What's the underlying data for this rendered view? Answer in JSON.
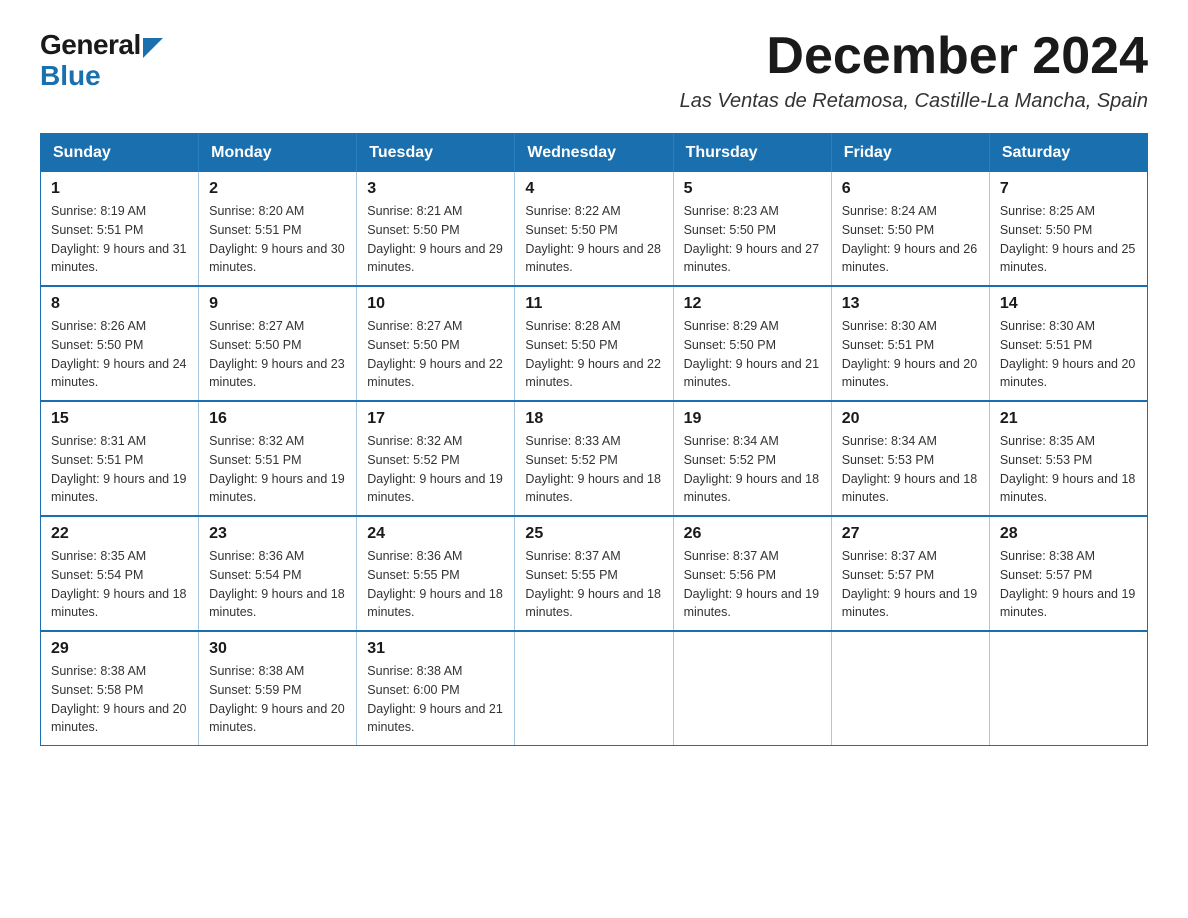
{
  "header": {
    "logo_general": "General",
    "logo_blue": "Blue",
    "month_year": "December 2024",
    "location": "Las Ventas de Retamosa, Castille-La Mancha, Spain"
  },
  "calendar": {
    "days_of_week": [
      "Sunday",
      "Monday",
      "Tuesday",
      "Wednesday",
      "Thursday",
      "Friday",
      "Saturday"
    ],
    "weeks": [
      [
        {
          "day": "1",
          "sunrise": "8:19 AM",
          "sunset": "5:51 PM",
          "daylight": "9 hours and 31 minutes."
        },
        {
          "day": "2",
          "sunrise": "8:20 AM",
          "sunset": "5:51 PM",
          "daylight": "9 hours and 30 minutes."
        },
        {
          "day": "3",
          "sunrise": "8:21 AM",
          "sunset": "5:50 PM",
          "daylight": "9 hours and 29 minutes."
        },
        {
          "day": "4",
          "sunrise": "8:22 AM",
          "sunset": "5:50 PM",
          "daylight": "9 hours and 28 minutes."
        },
        {
          "day": "5",
          "sunrise": "8:23 AM",
          "sunset": "5:50 PM",
          "daylight": "9 hours and 27 minutes."
        },
        {
          "day": "6",
          "sunrise": "8:24 AM",
          "sunset": "5:50 PM",
          "daylight": "9 hours and 26 minutes."
        },
        {
          "day": "7",
          "sunrise": "8:25 AM",
          "sunset": "5:50 PM",
          "daylight": "9 hours and 25 minutes."
        }
      ],
      [
        {
          "day": "8",
          "sunrise": "8:26 AM",
          "sunset": "5:50 PM",
          "daylight": "9 hours and 24 minutes."
        },
        {
          "day": "9",
          "sunrise": "8:27 AM",
          "sunset": "5:50 PM",
          "daylight": "9 hours and 23 minutes."
        },
        {
          "day": "10",
          "sunrise": "8:27 AM",
          "sunset": "5:50 PM",
          "daylight": "9 hours and 22 minutes."
        },
        {
          "day": "11",
          "sunrise": "8:28 AM",
          "sunset": "5:50 PM",
          "daylight": "9 hours and 22 minutes."
        },
        {
          "day": "12",
          "sunrise": "8:29 AM",
          "sunset": "5:50 PM",
          "daylight": "9 hours and 21 minutes."
        },
        {
          "day": "13",
          "sunrise": "8:30 AM",
          "sunset": "5:51 PM",
          "daylight": "9 hours and 20 minutes."
        },
        {
          "day": "14",
          "sunrise": "8:30 AM",
          "sunset": "5:51 PM",
          "daylight": "9 hours and 20 minutes."
        }
      ],
      [
        {
          "day": "15",
          "sunrise": "8:31 AM",
          "sunset": "5:51 PM",
          "daylight": "9 hours and 19 minutes."
        },
        {
          "day": "16",
          "sunrise": "8:32 AM",
          "sunset": "5:51 PM",
          "daylight": "9 hours and 19 minutes."
        },
        {
          "day": "17",
          "sunrise": "8:32 AM",
          "sunset": "5:52 PM",
          "daylight": "9 hours and 19 minutes."
        },
        {
          "day": "18",
          "sunrise": "8:33 AM",
          "sunset": "5:52 PM",
          "daylight": "9 hours and 18 minutes."
        },
        {
          "day": "19",
          "sunrise": "8:34 AM",
          "sunset": "5:52 PM",
          "daylight": "9 hours and 18 minutes."
        },
        {
          "day": "20",
          "sunrise": "8:34 AM",
          "sunset": "5:53 PM",
          "daylight": "9 hours and 18 minutes."
        },
        {
          "day": "21",
          "sunrise": "8:35 AM",
          "sunset": "5:53 PM",
          "daylight": "9 hours and 18 minutes."
        }
      ],
      [
        {
          "day": "22",
          "sunrise": "8:35 AM",
          "sunset": "5:54 PM",
          "daylight": "9 hours and 18 minutes."
        },
        {
          "day": "23",
          "sunrise": "8:36 AM",
          "sunset": "5:54 PM",
          "daylight": "9 hours and 18 minutes."
        },
        {
          "day": "24",
          "sunrise": "8:36 AM",
          "sunset": "5:55 PM",
          "daylight": "9 hours and 18 minutes."
        },
        {
          "day": "25",
          "sunrise": "8:37 AM",
          "sunset": "5:55 PM",
          "daylight": "9 hours and 18 minutes."
        },
        {
          "day": "26",
          "sunrise": "8:37 AM",
          "sunset": "5:56 PM",
          "daylight": "9 hours and 19 minutes."
        },
        {
          "day": "27",
          "sunrise": "8:37 AM",
          "sunset": "5:57 PM",
          "daylight": "9 hours and 19 minutes."
        },
        {
          "day": "28",
          "sunrise": "8:38 AM",
          "sunset": "5:57 PM",
          "daylight": "9 hours and 19 minutes."
        }
      ],
      [
        {
          "day": "29",
          "sunrise": "8:38 AM",
          "sunset": "5:58 PM",
          "daylight": "9 hours and 20 minutes."
        },
        {
          "day": "30",
          "sunrise": "8:38 AM",
          "sunset": "5:59 PM",
          "daylight": "9 hours and 20 minutes."
        },
        {
          "day": "31",
          "sunrise": "8:38 AM",
          "sunset": "6:00 PM",
          "daylight": "9 hours and 21 minutes."
        },
        null,
        null,
        null,
        null
      ]
    ]
  }
}
